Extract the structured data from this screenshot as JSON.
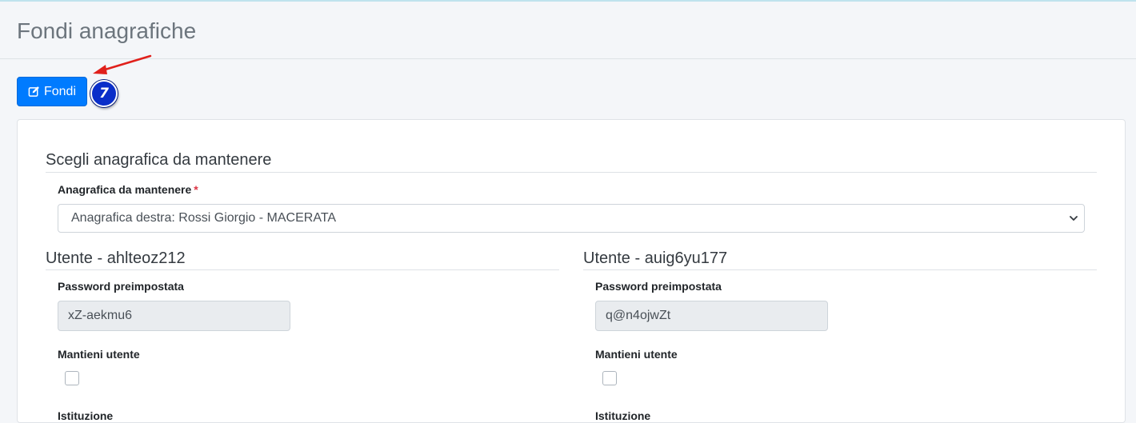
{
  "page": {
    "title": "Fondi anagrafiche"
  },
  "toolbar": {
    "fondi_label": "Fondi",
    "step_badge": "7"
  },
  "section_keep": {
    "title": "Scegli anagrafica da mantenere",
    "field_label": "Anagrafica da mantenere",
    "required_mark": "*",
    "selected_value": "Anagrafica destra: Rossi Giorgio - MACERATA"
  },
  "users": [
    {
      "title": "Utente - ahlteoz212",
      "password_label": "Password preimpostata",
      "password_value": "xZ-aekmu6",
      "keep_label": "Mantieni utente",
      "keep_checked": false,
      "next_label_partial": "Istituzione"
    },
    {
      "title": "Utente - auig6yu177",
      "password_label": "Password preimpostata",
      "password_value": "q@n4ojwZt",
      "keep_label": "Mantieni utente",
      "keep_checked": false,
      "next_label_partial": "Istituzione"
    }
  ],
  "colors": {
    "primary": "#007bff",
    "badge": "#0a2ec9",
    "arrow": "#e0201b",
    "required": "#dc3545"
  }
}
